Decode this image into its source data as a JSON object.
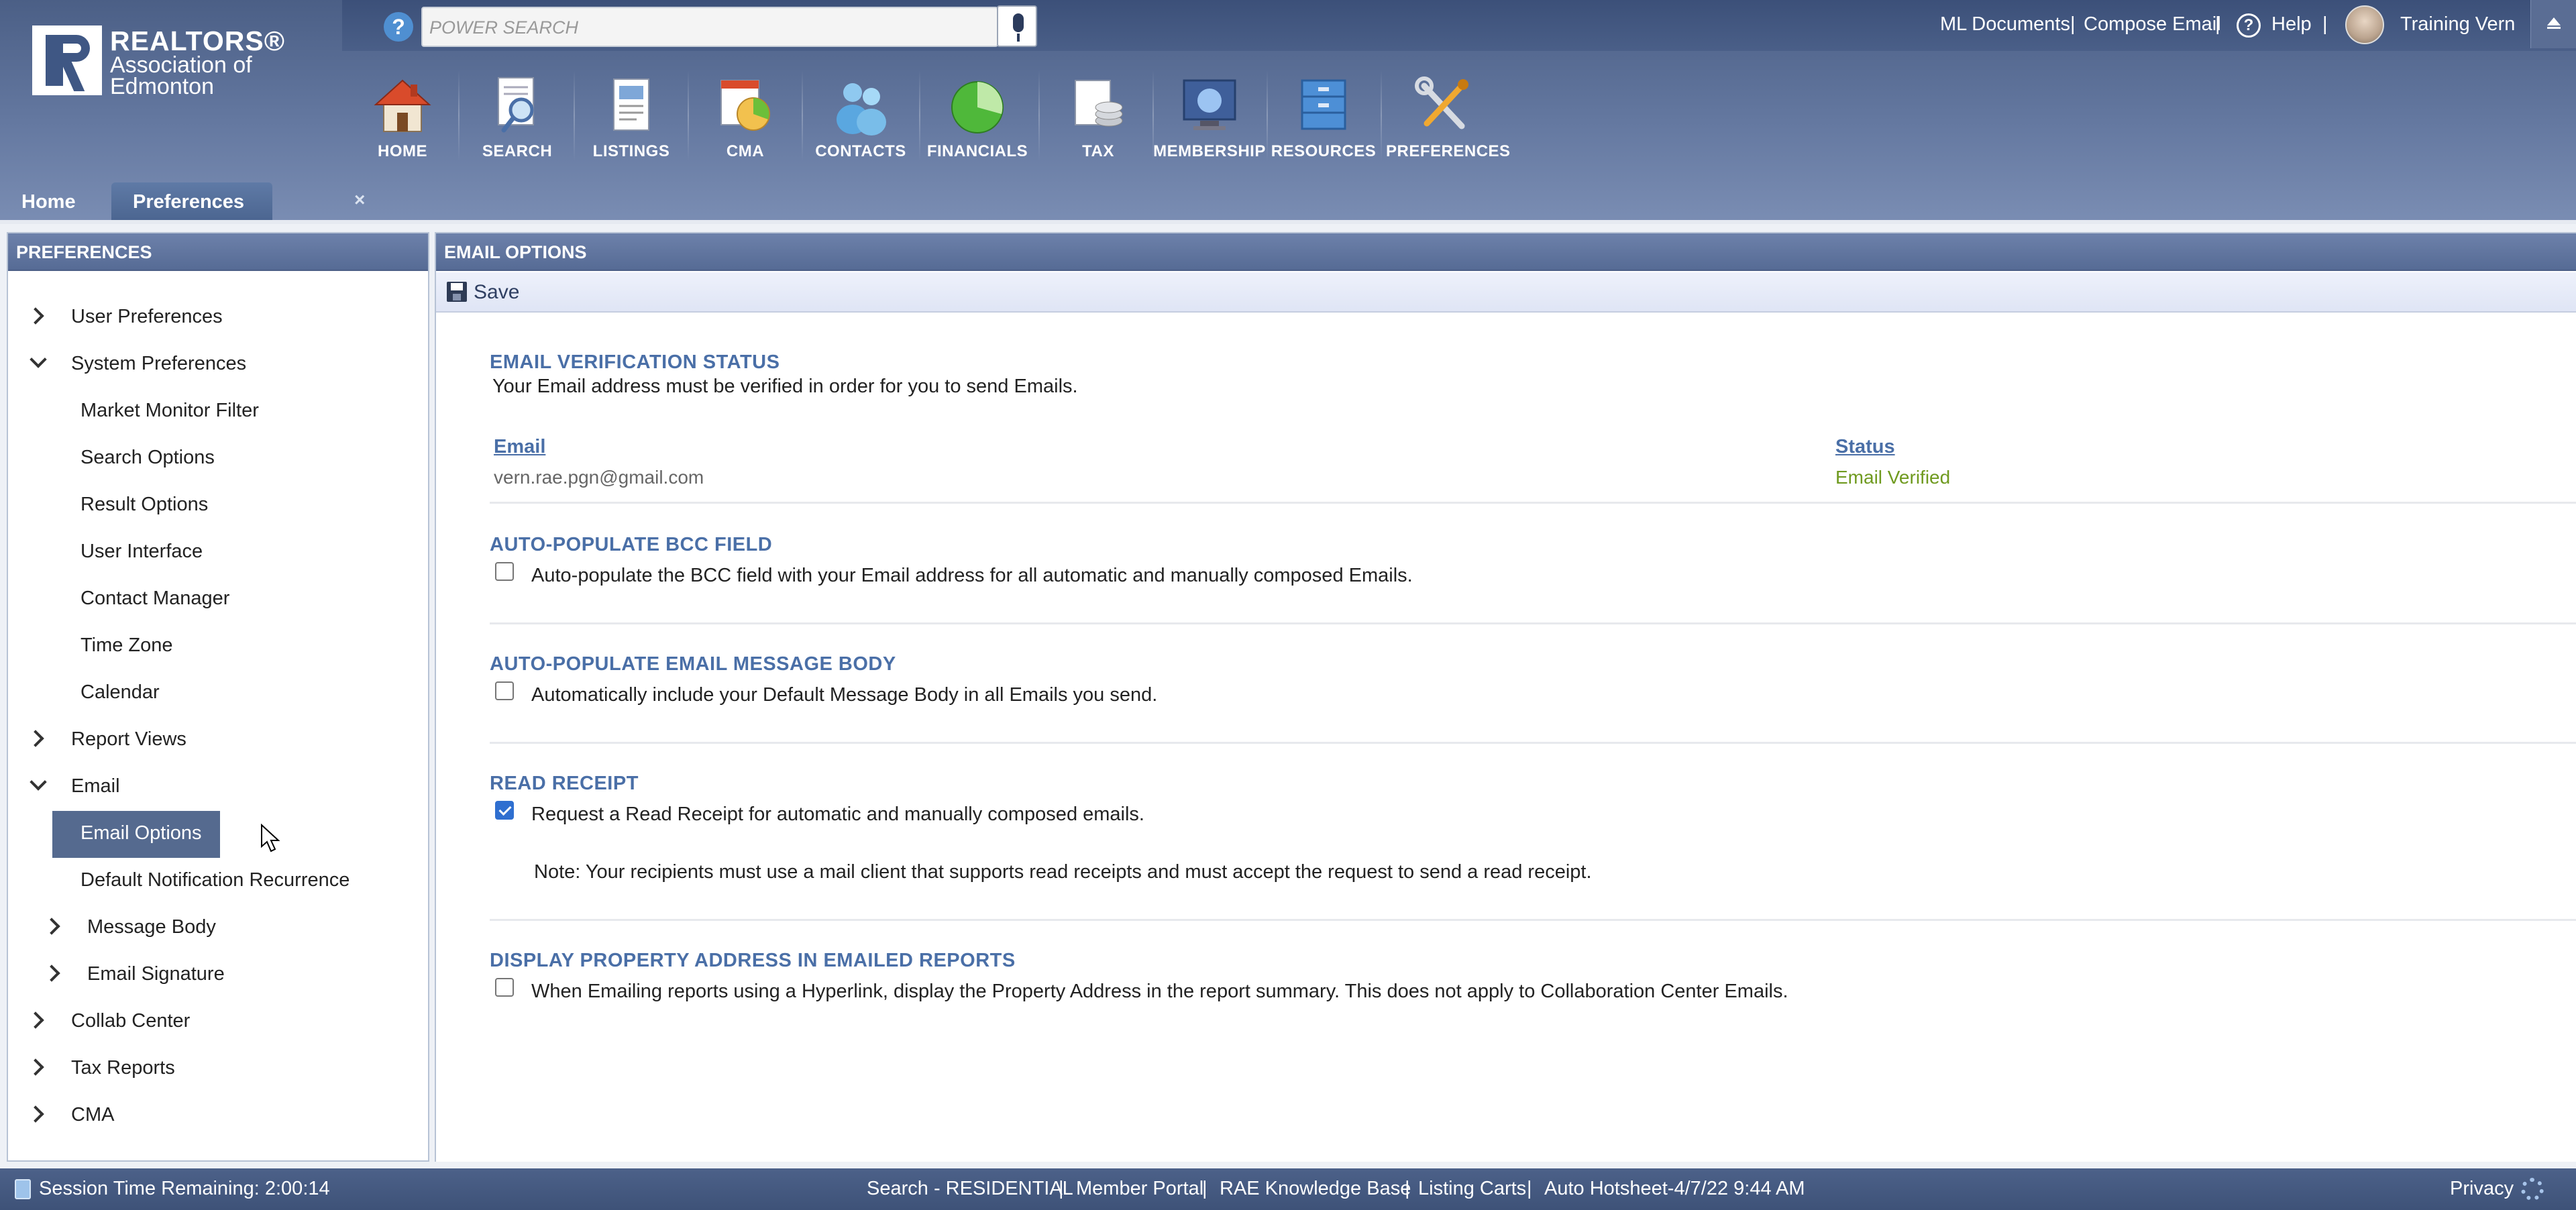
{
  "header": {
    "logo": {
      "line1": "REALTORS®",
      "line2": "Association of",
      "line3": "Edmonton"
    },
    "search": {
      "placeholder": "POWER SEARCH",
      "help": "?"
    },
    "links": {
      "ml_documents": "ML Documents",
      "compose_email": "Compose Email",
      "help": "Help",
      "user_name": "Training Vern",
      "separator": "|"
    },
    "nav": [
      {
        "label": "HOME",
        "icon": "home-icon"
      },
      {
        "label": "SEARCH",
        "icon": "search-icon"
      },
      {
        "label": "LISTINGS",
        "icon": "listings-icon"
      },
      {
        "label": "CMA",
        "icon": "cma-icon"
      },
      {
        "label": "CONTACTS",
        "icon": "contacts-icon"
      },
      {
        "label": "FINANCIALS",
        "icon": "financials-icon"
      },
      {
        "label": "TAX",
        "icon": "tax-icon"
      },
      {
        "label": "MEMBERSHIP",
        "icon": "membership-icon"
      },
      {
        "label": "RESOURCES",
        "icon": "resources-icon"
      },
      {
        "label": "PREFERENCES",
        "icon": "preferences-icon"
      }
    ],
    "tabs": [
      {
        "label": "Home"
      },
      {
        "label": "Preferences",
        "close": "×",
        "active": true
      }
    ]
  },
  "sidebar": {
    "title": "PREFERENCES",
    "items": [
      {
        "label": "User Preferences",
        "expander": "collapsed"
      },
      {
        "label": "System Preferences",
        "expander": "expanded"
      },
      {
        "label": "Market Monitor Filter"
      },
      {
        "label": "Search Options"
      },
      {
        "label": "Result Options"
      },
      {
        "label": "User Interface"
      },
      {
        "label": "Contact Manager"
      },
      {
        "label": "Time Zone"
      },
      {
        "label": "Calendar"
      },
      {
        "label": "Report Views",
        "expander": "collapsed"
      },
      {
        "label": "Email",
        "expander": "expanded"
      },
      {
        "label": "Email Options",
        "selected": true
      },
      {
        "label": "Default Notification Recurrence"
      },
      {
        "label": "Message Body",
        "expander": "collapsed"
      },
      {
        "label": "Email Signature",
        "expander": "collapsed"
      },
      {
        "label": "Collab Center",
        "expander": "collapsed"
      },
      {
        "label": "Tax Reports",
        "expander": "collapsed"
      },
      {
        "label": "CMA",
        "expander": "collapsed"
      }
    ]
  },
  "main": {
    "title": "EMAIL OPTIONS",
    "save_label": "Save",
    "verification": {
      "title": "EMAIL VERIFICATION STATUS",
      "desc": "Your Email address must be verified in order for you to send Emails.",
      "email_header": "Email",
      "status_header": "Status",
      "email_value": "vern.rae.pgn@gmail.com",
      "status_value": "Email Verified"
    },
    "bcc": {
      "title": "AUTO-POPULATE BCC FIELD",
      "text": "Auto-populate the BCC field with your Email address for all automatic and manually composed Emails.",
      "checked": false
    },
    "body": {
      "title": "AUTO-POPULATE EMAIL MESSAGE BODY",
      "text": "Automatically include your Default Message Body in all Emails you send.",
      "checked": false
    },
    "receipt": {
      "title": "READ RECEIPT",
      "text": "Request a Read Receipt for automatic and manually composed emails.",
      "note": "Note: Your recipients must use a mail client that supports read receipts and must accept the request to send a read receipt.",
      "checked": true
    },
    "address": {
      "title": "DISPLAY PROPERTY ADDRESS IN EMAILED REPORTS",
      "text": "When Emailing reports using a Hyperlink, display the Property Address in the report summary. This does not apply to Collaboration Center Emails.",
      "checked": false
    }
  },
  "footer": {
    "session": "Session Time Remaining: 2:00:14",
    "links": [
      "Search - RESIDENTIAL",
      "Member Portal",
      "RAE Knowledge Base",
      "Listing Carts",
      "Auto Hotsheet-4/7/22 9:44 AM"
    ],
    "separator": "|",
    "privacy": "Privacy"
  },
  "colors": {
    "header_bg": "#5a6d94",
    "section_title": "#4a6fa7",
    "verified_status": "#6f9a1f",
    "selected_item_bg": "#556a8f",
    "checkbox_checked": "#2f6fd0"
  }
}
